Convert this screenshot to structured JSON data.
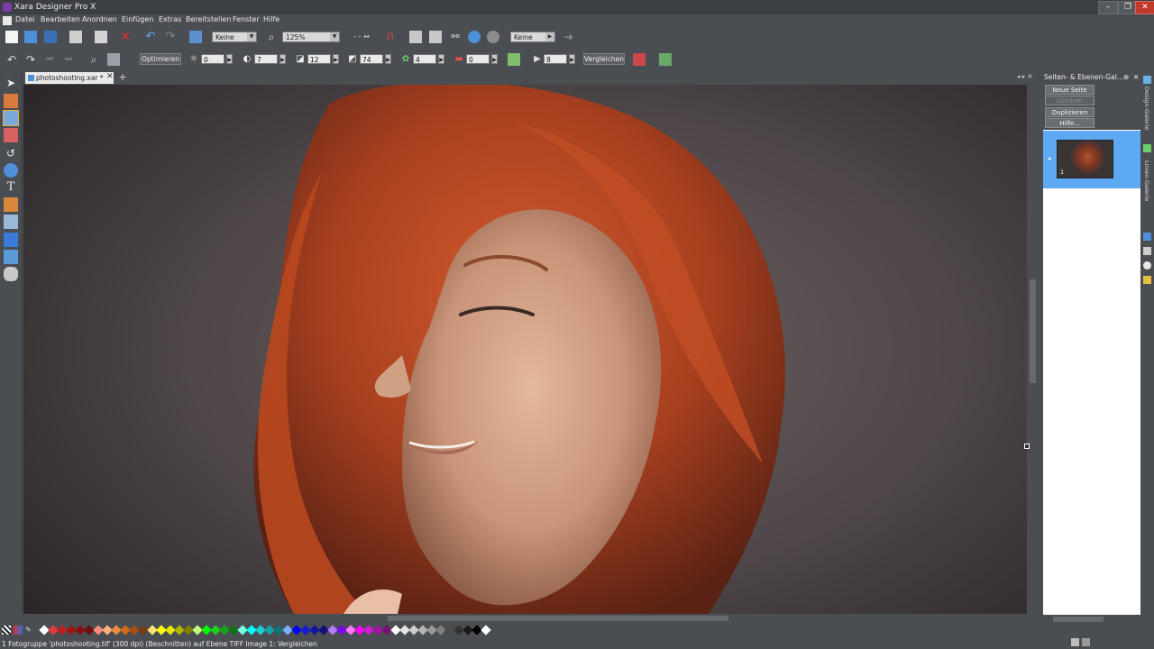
{
  "app": {
    "title": "Xara Designer Pro X"
  },
  "menu": [
    "Datei",
    "Bearbeiten",
    "Anordnen",
    "Einfügen",
    "Extras",
    "Bereitstellen",
    "Fenster",
    "Hilfe"
  ],
  "toolbar1": {
    "combo1": "Keine",
    "zoom": "125%",
    "combo2": "Keine"
  },
  "toolbar2": {
    "optimize_label": "Optimieren",
    "brightness": "0",
    "contrast": "7",
    "saturation": "12",
    "sharpen": "74",
    "color_value": "4",
    "effect_value": "0",
    "play_value": "8",
    "compare_label": "Vergleichen"
  },
  "document_tab": {
    "label": "photoshooting.xar *"
  },
  "gallery": {
    "title": "Seiten- & Ebenen-Gal...",
    "new_page": "Neue Seite",
    "delete": "Löschen",
    "duplicate": "Duplizieren",
    "help": "Hilfe...",
    "page_number": "1"
  },
  "side_tabs": [
    "Design-Galerie",
    "Linien-Galerie"
  ],
  "status": {
    "text": "1 Fotogruppe 'photoshooting.tif' (300 dpi) (Beschnitten) auf Ebene TIFF Image 1: Vergleichen"
  },
  "colors": {
    "accent_selection": "#5ea9f3",
    "close_button": "#c03a2b",
    "hair": "#b4482a"
  },
  "palette": [
    "#ffffff",
    "#e23b3b",
    "#c41d1d",
    "#a01414",
    "#8a1010",
    "#6d0d0d",
    "#ff8a7a",
    "#ffb07a",
    "#f08a3a",
    "#d46a18",
    "#a85012",
    "#7a3b0d",
    "#ffe07a",
    "#ffff00",
    "#e6e600",
    "#b3b300",
    "#808000",
    "#c8ff7a",
    "#00ff00",
    "#1ed11e",
    "#16a316",
    "#0f750f",
    "#7affe0",
    "#00ffff",
    "#1ad1d1",
    "#14a3a3",
    "#0f7575",
    "#7ab4ff",
    "#0000ff",
    "#1a1ad1",
    "#1414a3",
    "#0f0f75",
    "#b47aff",
    "#8000ff",
    "#ff7aff",
    "#ff00ff",
    "#d11ad1",
    "#a314a3",
    "#751075",
    "#ffffff",
    "#e6e6e6",
    "#cccccc",
    "#b3b3b3",
    "#999999",
    "#808080",
    "#4d4d4d",
    "#333333",
    "#1a1a1a",
    "#000000",
    "#ffffff"
  ]
}
